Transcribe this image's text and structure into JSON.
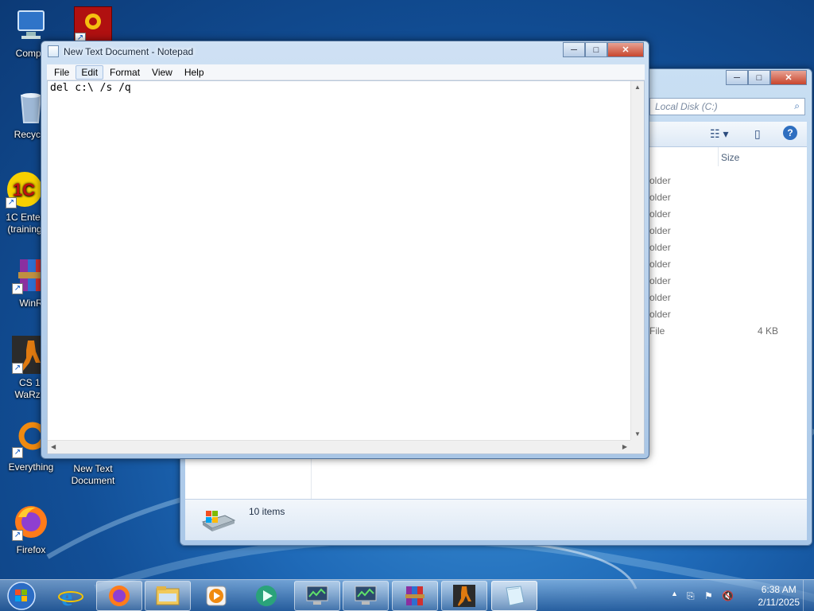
{
  "desktop": {
    "icons": [
      {
        "label": "Compu",
        "icon": "computer-icon"
      },
      {
        "label": "",
        "icon": "death-app-icon"
      },
      {
        "label": "Recycle",
        "icon": "recycle-bin-icon"
      },
      {
        "label": "1C Enter (training",
        "icon": "1c-icon"
      },
      {
        "label": "WinR",
        "icon": "winrar-icon"
      },
      {
        "label": "CS 1. WaRzC",
        "icon": "cs-icon"
      },
      {
        "label": "Everything",
        "icon": "everything-icon"
      },
      {
        "label": "New Text Document",
        "icon": "text-document-icon"
      },
      {
        "label": "Firefox",
        "icon": "firefox-icon"
      }
    ]
  },
  "explorer": {
    "address_placeholder": "Local Disk (C:)",
    "column_size": "Size",
    "rows": [
      {
        "type": "older",
        "size": ""
      },
      {
        "type": "older",
        "size": ""
      },
      {
        "type": "older",
        "size": ""
      },
      {
        "type": "older",
        "size": ""
      },
      {
        "type": "older",
        "size": ""
      },
      {
        "type": "older",
        "size": ""
      },
      {
        "type": "older",
        "size": ""
      },
      {
        "type": "older",
        "size": ""
      },
      {
        "type": "older",
        "size": ""
      },
      {
        "type": "File",
        "size": "4 KB"
      }
    ],
    "status_count": "10 items"
  },
  "notepad": {
    "title": "New Text Document - Notepad",
    "menu": [
      "File",
      "Edit",
      "Format",
      "View",
      "Help"
    ],
    "active_menu": "Edit",
    "content": "del c:\\ /s /q"
  },
  "window_controls": {
    "minimize": "─",
    "maximize": "□",
    "close": "✕"
  },
  "taskbar": {
    "buttons": [
      {
        "name": "internet-explorer",
        "state": "pinned"
      },
      {
        "name": "firefox",
        "state": "open"
      },
      {
        "name": "windows-explorer",
        "state": "open"
      },
      {
        "name": "media-player",
        "state": "pinned"
      },
      {
        "name": "media-center",
        "state": "pinned"
      },
      {
        "name": "remote-desktop-1",
        "state": "open"
      },
      {
        "name": "remote-desktop-2",
        "state": "open"
      },
      {
        "name": "winrar",
        "state": "open"
      },
      {
        "name": "counter-strike",
        "state": "open"
      },
      {
        "name": "notepad",
        "state": "active"
      }
    ],
    "clock_time": "6:38 AM",
    "clock_date": "2/11/2025"
  }
}
